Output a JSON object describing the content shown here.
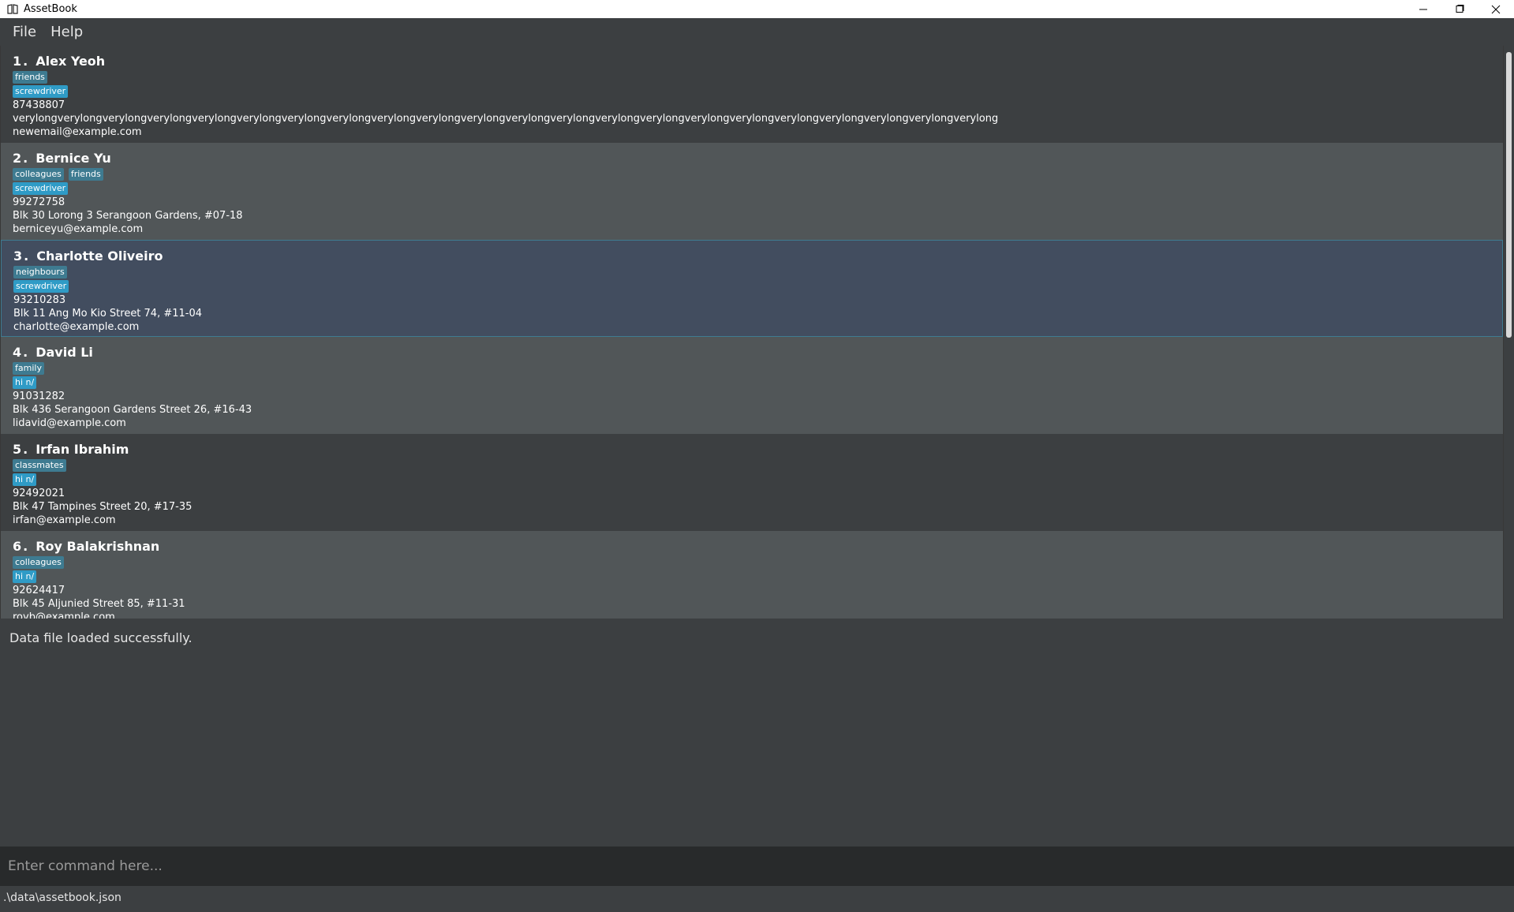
{
  "window": {
    "title": "AssetBook",
    "icon": "book-icon",
    "minimize_icon": "minimize-icon",
    "maximize_icon": "maximize-icon",
    "close_icon": "close-icon"
  },
  "menu": {
    "file": "File",
    "help": "Help"
  },
  "contacts": [
    {
      "index": "1.",
      "name": "Alex Yeoh",
      "tags": [
        "friends"
      ],
      "assets": [
        "screwdriver"
      ],
      "phone": "87438807",
      "address": "verylongverylongverylongverylongverylongverylongverylongverylongverylongverylongverylongverylongverylongverylongverylongverylongverylongverylongverylongverylongverylongverylong",
      "email": "newemail@example.com"
    },
    {
      "index": "2.",
      "name": "Bernice Yu",
      "tags": [
        "colleagues",
        "friends"
      ],
      "assets": [
        "screwdriver"
      ],
      "phone": "99272758",
      "address": "Blk 30 Lorong 3 Serangoon Gardens, #07-18",
      "email": "berniceyu@example.com"
    },
    {
      "index": "3.",
      "name": "Charlotte Oliveiro",
      "tags": [
        "neighbours"
      ],
      "assets": [
        "screwdriver"
      ],
      "phone": "93210283",
      "address": "Blk 11 Ang Mo Kio Street 74, #11-04",
      "email": "charlotte@example.com"
    },
    {
      "index": "4.",
      "name": "David Li",
      "tags": [
        "family"
      ],
      "assets": [
        "hi n/"
      ],
      "phone": "91031282",
      "address": "Blk 436 Serangoon Gardens Street 26, #16-43",
      "email": "lidavid@example.com"
    },
    {
      "index": "5.",
      "name": "Irfan Ibrahim",
      "tags": [
        "classmates"
      ],
      "assets": [
        "hi n/"
      ],
      "phone": "92492021",
      "address": "Blk 47 Tampines Street 20, #17-35",
      "email": "irfan@example.com"
    },
    {
      "index": "6.",
      "name": "Roy Balakrishnan",
      "tags": [
        "colleagues"
      ],
      "assets": [
        "hi n/"
      ],
      "phone": "92624417",
      "address": "Blk 45 Aljunied Street 85, #11-31",
      "email": "royb@example.com"
    }
  ],
  "result": {
    "message": "Data file loaded successfully."
  },
  "command": {
    "placeholder": "Enter command here...",
    "value": ""
  },
  "status": {
    "path": ".\\data\\assetbook.json"
  },
  "colors": {
    "tag": "#3e7b91",
    "asset": "#2f9bc6",
    "selected": "#424d5f",
    "background": "#3c3f41"
  }
}
